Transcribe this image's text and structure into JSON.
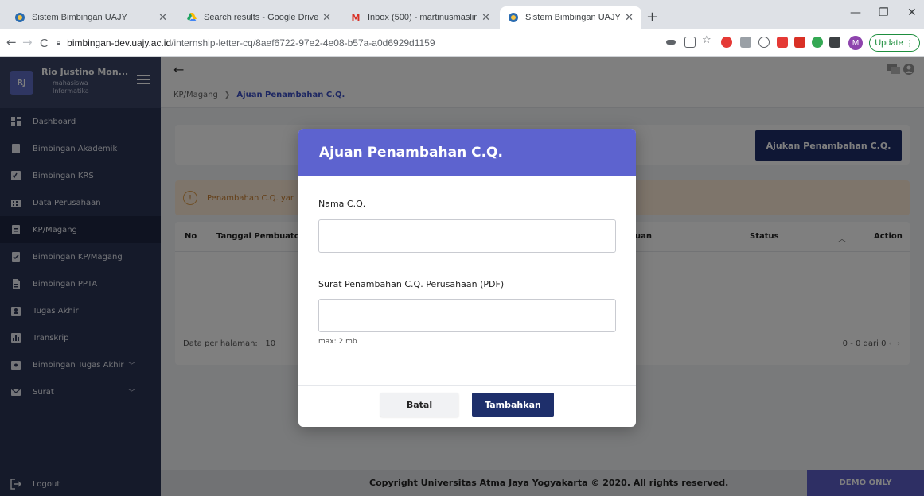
{
  "browser": {
    "tabs": [
      {
        "title": "Sistem Bimbingan UAJY",
        "active": false
      },
      {
        "title": "Search results - Google Drive",
        "active": false
      },
      {
        "title": "Inbox (500) - martinusmaslim122",
        "active": false
      },
      {
        "title": "Sistem Bimbingan UAJY",
        "active": true
      }
    ],
    "url_host": "bimbingan-dev.uajy.ac.id",
    "url_path": "/internship-letter-cq/8aef6722-97e2-4e08-b57a-a0d6929d1159",
    "profile_initial": "M",
    "update_label": "Update"
  },
  "user": {
    "initials": "RJ",
    "name": "Rio Justino Mon...",
    "role": "mahasiswa",
    "program": "Informatika"
  },
  "sidebar": {
    "items": [
      {
        "label": "Dashboard",
        "icon": "dashboard-icon"
      },
      {
        "label": "Bimbingan Akademik",
        "icon": "book-icon"
      },
      {
        "label": "Bimbingan KRS",
        "icon": "check-list-icon"
      },
      {
        "label": "Data Perusahaan",
        "icon": "building-icon"
      },
      {
        "label": "KP/Magang",
        "icon": "clipboard-icon",
        "active": true
      },
      {
        "label": "Bimbingan KP/Magang",
        "icon": "clipboard-check-icon"
      },
      {
        "label": "Bimbingan PPTA",
        "icon": "document-icon"
      },
      {
        "label": "Tugas Akhir",
        "icon": "person-badge-icon"
      },
      {
        "label": "Transkrip",
        "icon": "chart-icon"
      },
      {
        "label": "Bimbingan Tugas Akhir",
        "icon": "folder-icon",
        "expandable": true
      },
      {
        "label": "Surat",
        "icon": "mail-icon",
        "expandable": true
      }
    ],
    "logout": "Logout"
  },
  "breadcrumb": {
    "parent": "KP/Magang",
    "current": "Ajuan Penambahan C.Q."
  },
  "page": {
    "ajukan_button": "Ajukan Penambahan C.Q.",
    "alert_text": "Penambahan C.Q. yar",
    "table_headers": {
      "no": "No",
      "tanggal": "Tanggal Pembuatc",
      "ajuan": "uan",
      "status": "Status",
      "action": "Action"
    },
    "per_page_label": "Data per halaman:",
    "per_page_value": "10",
    "pagination": "0 - 0 dari 0"
  },
  "footer": {
    "copyright": "Copyright Universitas Atma Jaya Yogyakarta © 2020. All rights reserved.",
    "demo": "DEMO ONLY"
  },
  "modal": {
    "title": "Ajuan Penambahan C.Q.",
    "field1_label": "Nama C.Q.",
    "field1_value": "",
    "field2_label": "Surat Penambahan C.Q. Perusahaan (PDF)",
    "field2_value": "",
    "hint": "max: 2 mb",
    "cancel": "Batal",
    "submit": "Tambahkan"
  }
}
